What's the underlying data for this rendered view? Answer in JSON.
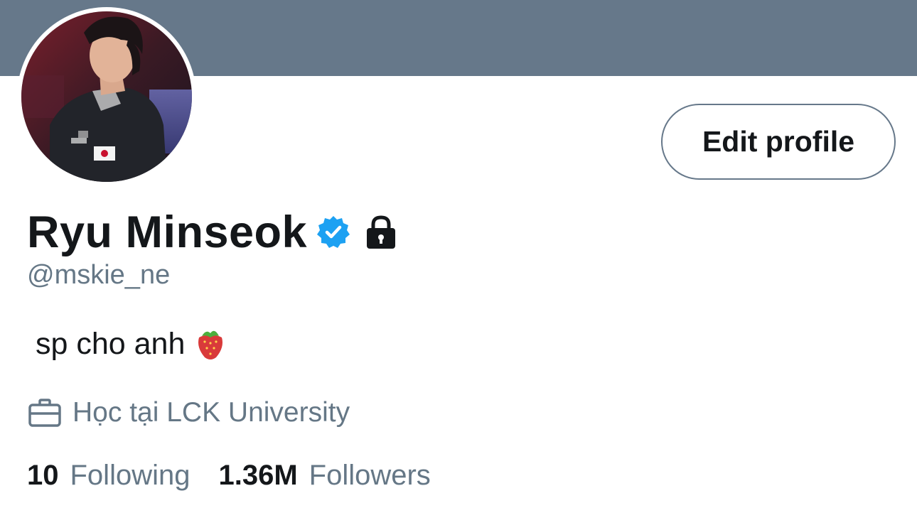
{
  "profile": {
    "display_name": "Ryu Minseok",
    "handle": "@mskie_ne",
    "bio": "sp cho anh",
    "work": "Học tại LCK University",
    "verified": true,
    "protected": true
  },
  "actions": {
    "edit_profile_label": "Edit profile"
  },
  "stats": {
    "following_count": "10",
    "following_label": "Following",
    "followers_count": "1.36M",
    "followers_label": "Followers"
  },
  "icons": {
    "verified": "verified-badge-icon",
    "lock": "lock-icon",
    "work": "briefcase-icon",
    "bio_emoji": "strawberry-icon"
  },
  "colors": {
    "banner": "#66788a",
    "verified": "#1da1f2",
    "secondary_text": "#657786",
    "primary_text": "#14171a"
  }
}
